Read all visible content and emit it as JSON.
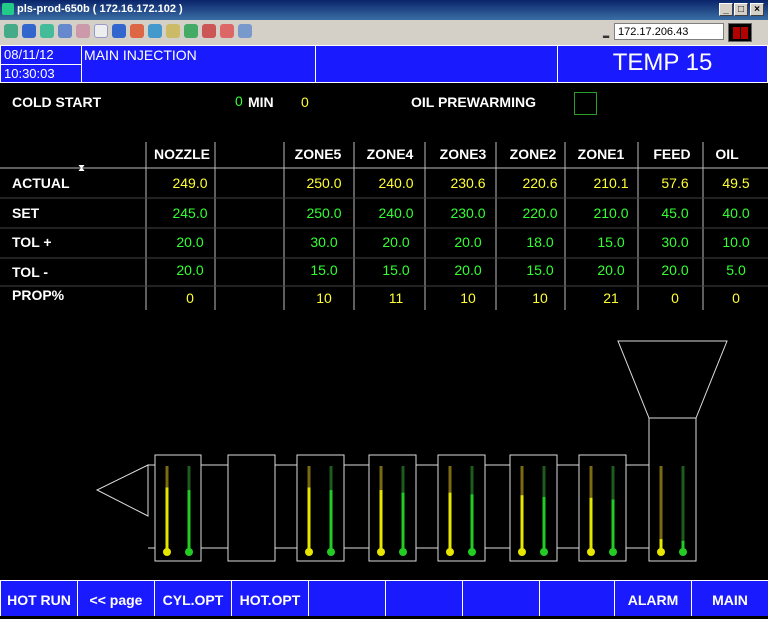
{
  "window": {
    "title": "pls-prod-650b ( 172.16.172.102 )",
    "ip": "172.17.206.43"
  },
  "header": {
    "date": "08/11/12",
    "time": "10:30:03",
    "screen": "MAIN INJECTION",
    "page_title": "TEMP 15"
  },
  "cold_start": {
    "label": "COLD START",
    "minutes": "0",
    "unit": "MIN",
    "value": "0"
  },
  "oil_prewarming": {
    "label": "OIL PREWARMING"
  },
  "table": {
    "columns": [
      "NOZZLE",
      "",
      "ZONE5",
      "ZONE4",
      "ZONE3",
      "ZONE2",
      "ZONE1",
      "FEED",
      "OIL"
    ],
    "rows": [
      {
        "label": "ACTUAL",
        "values": [
          "249.0",
          "",
          "250.0",
          "240.0",
          "230.6",
          "220.6",
          "210.1",
          "57.6",
          "49.5"
        ],
        "color": "yellow"
      },
      {
        "label": "SET",
        "values": [
          "245.0",
          "",
          "250.0",
          "240.0",
          "230.0",
          "220.0",
          "210.0",
          "45.0",
          "40.0"
        ],
        "color": "green"
      },
      {
        "label": "TOL +",
        "values": [
          "20.0",
          "",
          "30.0",
          "20.0",
          "20.0",
          "18.0",
          "15.0",
          "30.0",
          "10.0"
        ],
        "color": "green"
      },
      {
        "label": "TOL -",
        "values": [
          "20.0",
          "",
          "15.0",
          "15.0",
          "20.0",
          "15.0",
          "20.0",
          "20.0",
          "5.0"
        ],
        "color": "green"
      },
      {
        "label": "PROP%",
        "values": [
          "0",
          "",
          "10",
          "11",
          "10",
          "10",
          "21",
          "0",
          "0"
        ],
        "color": "yellow"
      }
    ]
  },
  "barrel": {
    "zones": [
      {
        "actual_level": 0.75,
        "set_level": 0.72
      },
      null,
      {
        "actual_level": 0.75,
        "set_level": 0.72
      },
      {
        "actual_level": 0.72,
        "set_level": 0.69
      },
      {
        "actual_level": 0.69,
        "set_level": 0.67
      },
      {
        "actual_level": 0.66,
        "set_level": 0.64
      },
      {
        "actual_level": 0.63,
        "set_level": 0.61
      },
      {
        "actual_level": 0.15,
        "set_level": 0.13
      }
    ]
  },
  "footer": {
    "buttons": [
      "HOT RUN",
      "<< page",
      "CYL.OPT",
      "HOT.OPT",
      "",
      "",
      "",
      "",
      "ALARM",
      "MAIN"
    ]
  },
  "colors": {
    "header_blue": "#1a1aff",
    "actual": "#ffff33",
    "set": "#33ff33"
  }
}
